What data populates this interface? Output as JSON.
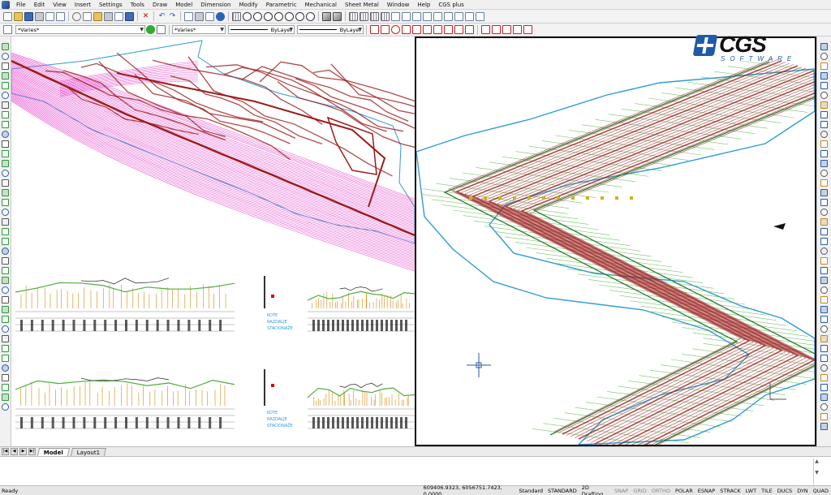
{
  "menu": [
    "File",
    "Edit",
    "View",
    "Insert",
    "Settings",
    "Tools",
    "Draw",
    "Model",
    "Dimension",
    "Modify",
    "Parametric",
    "Mechanical",
    "Sheet Metal",
    "Window",
    "Help",
    "CGS plus"
  ],
  "toolbar2": {
    "layer_combo": "*Varies*",
    "color_combo": "*Varies*",
    "linetype_combo": "ByLayer",
    "lineweight_combo": "ByLayer"
  },
  "logo": {
    "name": "CGS",
    "tagline": "SOFTWARE"
  },
  "profile_labels": {
    "left": [
      "KOTE",
      "RAZDALJE",
      "STACIONAŽE"
    ],
    "right": [
      "KOTE",
      "RAZDALJE",
      "STACIONAŽE"
    ]
  },
  "tabs": [
    "Model",
    "Layout1"
  ],
  "active_tab": "Model",
  "status": {
    "ready": "Ready",
    "coords": "609406.9323, 6056751.7423, 0.0000",
    "style": "Standard",
    "dimstyle": "STANDARD",
    "workspace": "2D Drafting",
    "toggles": [
      {
        "label": "SNAP",
        "on": false
      },
      {
        "label": "GRID",
        "on": false
      },
      {
        "label": "ORTHO",
        "on": false
      },
      {
        "label": "POLAR",
        "on": true
      },
      {
        "label": "ESNAP",
        "on": true
      },
      {
        "label": "STRACK",
        "on": true
      },
      {
        "label": "LWT",
        "on": true
      },
      {
        "label": "TILE",
        "on": true
      },
      {
        "label": "DUCS",
        "on": true
      },
      {
        "label": "DYN",
        "on": true
      },
      {
        "label": "QUAD",
        "on": true
      }
    ]
  },
  "colors": {
    "contour_red": "#9c1b1b",
    "road_magenta": "#e23cc8",
    "boundary_blue": "#2f9bd6",
    "cross_section_green": "#4caf3a",
    "profile_orange": "#d89a2a",
    "logo_blue": "#1f5aa6"
  }
}
